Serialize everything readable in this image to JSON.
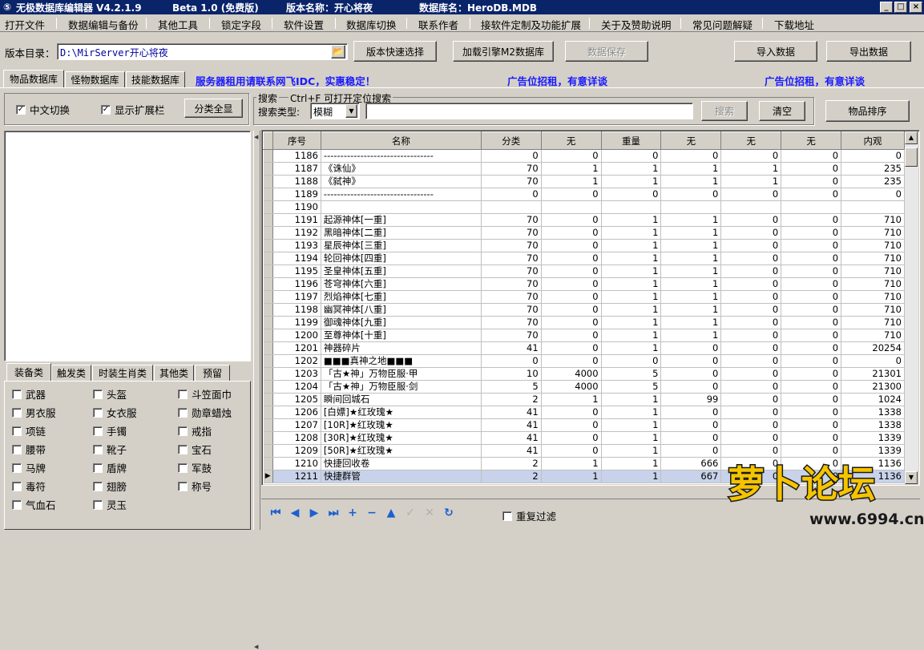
{
  "window": {
    "title": "无极数据库编辑器 V4.2.1.9",
    "edition": "Beta 1.0 (免费版)",
    "version_name": "版本名称：开心将夜",
    "db_name": "数据库名：HeroDB.MDB",
    "minimize": "_",
    "maximize": "□",
    "close": "×"
  },
  "menu": [
    "打开文件",
    "数据编辑与备份",
    "其他工具",
    "锁定字段",
    "软件设置",
    "数据库切换",
    "联系作者",
    "接软件定制及功能扩展",
    "关于及赞助说明",
    "常见问题解疑",
    "下载地址"
  ],
  "toolbar": {
    "dir_label": "版本目录：",
    "dir_value": "D:\\MirServer开心将夜",
    "quick_select": "版本快速选择",
    "load_engine": "加载引擎M2数据库",
    "save_data": "数据保存",
    "import_data": "导入数据",
    "export_data": "导出数据"
  },
  "db_tabs": [
    "物品数据库",
    "怪物数据库",
    "技能数据库"
  ],
  "ads": {
    "server": "服务器租用请联系网飞IDC，实惠稳定！",
    "ad1": "广告位招租，有意详谈",
    "ad2": "广告位招租，有意详谈"
  },
  "options": {
    "cn_switch": "中文切换",
    "show_ext": "显示扩展栏",
    "show_all": "分类全显"
  },
  "search": {
    "group_label": "搜索",
    "hint": "Ctrl+F 可打开定位搜索",
    "type_label": "搜索类型:",
    "type_value": "模糊",
    "search_btn": "搜索",
    "clear_btn": "清空",
    "sort_btn": "物品排序"
  },
  "category_tabs": [
    "装备类",
    "触发类",
    "时装生肖类",
    "其他类",
    "预留"
  ],
  "categories": [
    [
      "武器",
      "头盔",
      "斗笠面巾"
    ],
    [
      "男衣服",
      "女衣服",
      "勋章蜡烛"
    ],
    [
      "项链",
      "手镯",
      "戒指"
    ],
    [
      "腰带",
      "靴子",
      "宝石"
    ],
    [
      "马牌",
      "盾牌",
      "军鼓"
    ],
    [
      "毒符",
      "翅膀",
      "称号"
    ],
    [
      "气血石",
      "灵玉",
      ""
    ]
  ],
  "columns": [
    "序号",
    "名称",
    "分类",
    "无",
    "重量",
    "无",
    "无",
    "无",
    "内观"
  ],
  "rows": [
    [
      "1186",
      "---------------------------------",
      "0",
      "0",
      "0",
      "0",
      "0",
      "0",
      "0"
    ],
    [
      "1187",
      "《诛仙》",
      "70",
      "1",
      "1",
      "1",
      "1",
      "0",
      "235"
    ],
    [
      "1188",
      "《弑神》",
      "70",
      "1",
      "1",
      "1",
      "1",
      "0",
      "235"
    ],
    [
      "1189",
      "---------------------------------",
      "0",
      "0",
      "0",
      "0",
      "0",
      "0",
      "0"
    ],
    [
      "1190",
      "",
      "",
      "",
      "",
      "",
      "",
      "",
      ""
    ],
    [
      "1191",
      "起源神体[一重]",
      "70",
      "0",
      "1",
      "1",
      "0",
      "0",
      "710"
    ],
    [
      "1192",
      "黑暗神体[二重]",
      "70",
      "0",
      "1",
      "1",
      "0",
      "0",
      "710"
    ],
    [
      "1193",
      "星辰神体[三重]",
      "70",
      "0",
      "1",
      "1",
      "0",
      "0",
      "710"
    ],
    [
      "1194",
      "轮回神体[四重]",
      "70",
      "0",
      "1",
      "1",
      "0",
      "0",
      "710"
    ],
    [
      "1195",
      "圣皇神体[五重]",
      "70",
      "0",
      "1",
      "1",
      "0",
      "0",
      "710"
    ],
    [
      "1196",
      "苍穹神体[六重]",
      "70",
      "0",
      "1",
      "1",
      "0",
      "0",
      "710"
    ],
    [
      "1197",
      "烈焰神体[七重]",
      "70",
      "0",
      "1",
      "1",
      "0",
      "0",
      "710"
    ],
    [
      "1198",
      "幽冥神体[八重]",
      "70",
      "0",
      "1",
      "1",
      "0",
      "0",
      "710"
    ],
    [
      "1199",
      "御魂神体[九重]",
      "70",
      "0",
      "1",
      "1",
      "0",
      "0",
      "710"
    ],
    [
      "1200",
      "至尊神体[十重]",
      "70",
      "0",
      "1",
      "1",
      "0",
      "0",
      "710"
    ],
    [
      "1201",
      "神器碎片",
      "41",
      "0",
      "1",
      "0",
      "0",
      "0",
      "20254"
    ],
    [
      "1202",
      "■■■真神之地■■■",
      "0",
      "0",
      "0",
      "0",
      "0",
      "0",
      "0"
    ],
    [
      "1203",
      "「古★神」万物臣服·甲",
      "10",
      "4000",
      "5",
      "0",
      "0",
      "0",
      "21301"
    ],
    [
      "1204",
      "「古★神」万物臣服·剑",
      "5",
      "4000",
      "5",
      "0",
      "0",
      "0",
      "21300"
    ],
    [
      "1205",
      "瞬间回城石",
      "2",
      "1",
      "1",
      "99",
      "0",
      "0",
      "1024"
    ],
    [
      "1206",
      "[白嫖]★红玫瑰★",
      "41",
      "0",
      "1",
      "0",
      "0",
      "0",
      "1338"
    ],
    [
      "1207",
      "[10R]★红玫瑰★",
      "41",
      "0",
      "1",
      "0",
      "0",
      "0",
      "1338"
    ],
    [
      "1208",
      "[30R]★红玫瑰★",
      "41",
      "0",
      "1",
      "0",
      "0",
      "0",
      "1339"
    ],
    [
      "1209",
      "[50R]★红玫瑰★",
      "41",
      "0",
      "1",
      "0",
      "0",
      "0",
      "1339"
    ],
    [
      "1210",
      "快捷回收卷",
      "2",
      "1",
      "1",
      "666",
      "0",
      "0",
      "1136"
    ],
    [
      "1211",
      "快捷群管",
      "2",
      "1",
      "1",
      "667",
      "0",
      "0",
      "1136"
    ]
  ],
  "selected_row": "1211",
  "bottom": {
    "dup_filter": "重复过滤"
  },
  "watermark": {
    "brand": "萝卜论坛",
    "url": "www.6994.cn"
  }
}
